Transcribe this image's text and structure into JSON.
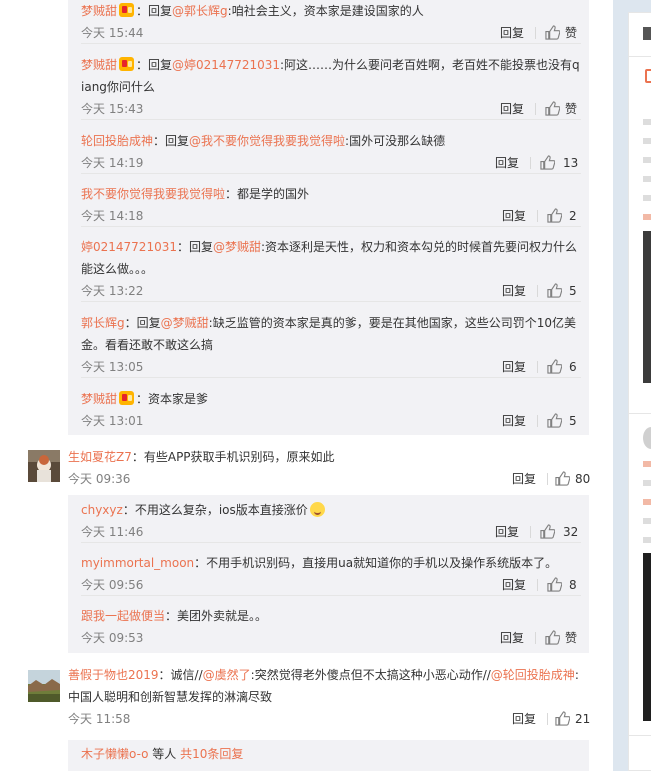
{
  "thread1": [
    {
      "user": "梦贼甜",
      "prefix": "：回复",
      "at": "@郭长辉g",
      "text": ":咱社会主义，资本家是建设国家的人",
      "time": "今天 15:44",
      "reply": "回复",
      "likes": "赞"
    },
    {
      "user": "梦贼甜",
      "prefix": "：回复",
      "at": "@婷02147721031",
      "text": ":阿这……为什么要问老百姓啊，老百姓不能投票也没有qiang你问什么",
      "time": "今天 15:43",
      "reply": "回复",
      "likes": "赞"
    },
    {
      "user": "轮回投胎成神",
      "prefix": "：回复",
      "at": "@我不要你觉得我要我觉得啦",
      "text": ":国外可没那么缺德",
      "time": "今天 14:19",
      "reply": "回复",
      "likes": "13"
    },
    {
      "user": "我不要你觉得我要我觉得啦",
      "prefix": "",
      "at": "",
      "text": "：都是学的国外",
      "time": "今天 14:18",
      "reply": "回复",
      "likes": "2"
    },
    {
      "user": "婷02147721031",
      "prefix": "：回复",
      "at": "@梦贼甜",
      "text": ":资本逐利是天性，权力和资本勾兑的时候首先要问权力什么能这么做。。。",
      "time": "今天 13:22",
      "reply": "回复",
      "likes": "5"
    },
    {
      "user": "郭长辉g",
      "prefix": "：回复",
      "at": "@梦贼甜",
      "text": ":缺乏监管的资本家是真的爹，要是在其他国家，这些公司罚个10亿美金。看看还敢不敢这么搞",
      "time": "今天 13:05",
      "reply": "回复",
      "likes": "6"
    },
    {
      "user": "梦贼甜",
      "prefix": "",
      "at": "",
      "text": "：资本家是爹",
      "time": "今天 13:01",
      "reply": "回复",
      "likes": "5"
    }
  ],
  "comment2": {
    "user": "生如夏花Z7",
    "text": "：有些APP获取手机识别码，原来如此",
    "time": "今天 09:36",
    "reply": "回复",
    "likes": "80"
  },
  "thread2": [
    {
      "user": "chyxyz",
      "text": "：不用这么复杂，ios版本直接涨价",
      "time": "今天 11:46",
      "reply": "回复",
      "likes": "32"
    },
    {
      "user": "myimmortal_moon",
      "text": "：不用手机识别码，直接用ua就知道你的手机以及操作系统版本了。",
      "time": "今天 09:56",
      "reply": "回复",
      "likes": "8"
    },
    {
      "user": "跟我一起做便当",
      "text": "：美团外卖就是。。",
      "time": "今天 09:53",
      "reply": "回复",
      "likes": "赞"
    }
  ],
  "comment3": {
    "user": "善假于物也2019",
    "text1": "：诚信//",
    "at1": "@虞然了",
    "text2": ":突然觉得老外傻点但不太搞这种小恶心动作//",
    "at2": "@轮回投胎成神",
    "text3": ":中国人聪明和创新智慧发挥的淋漓尽致",
    "time": "今天 11:58",
    "reply": "回复",
    "likes": "21"
  },
  "more": {
    "user": "木子懒懒o-o",
    "text": " 等人 ",
    "link": "共10条回复"
  },
  "colors": {
    "link": "#eb7350",
    "background": "#dde6ef",
    "subbox": "#f2f2f5"
  }
}
